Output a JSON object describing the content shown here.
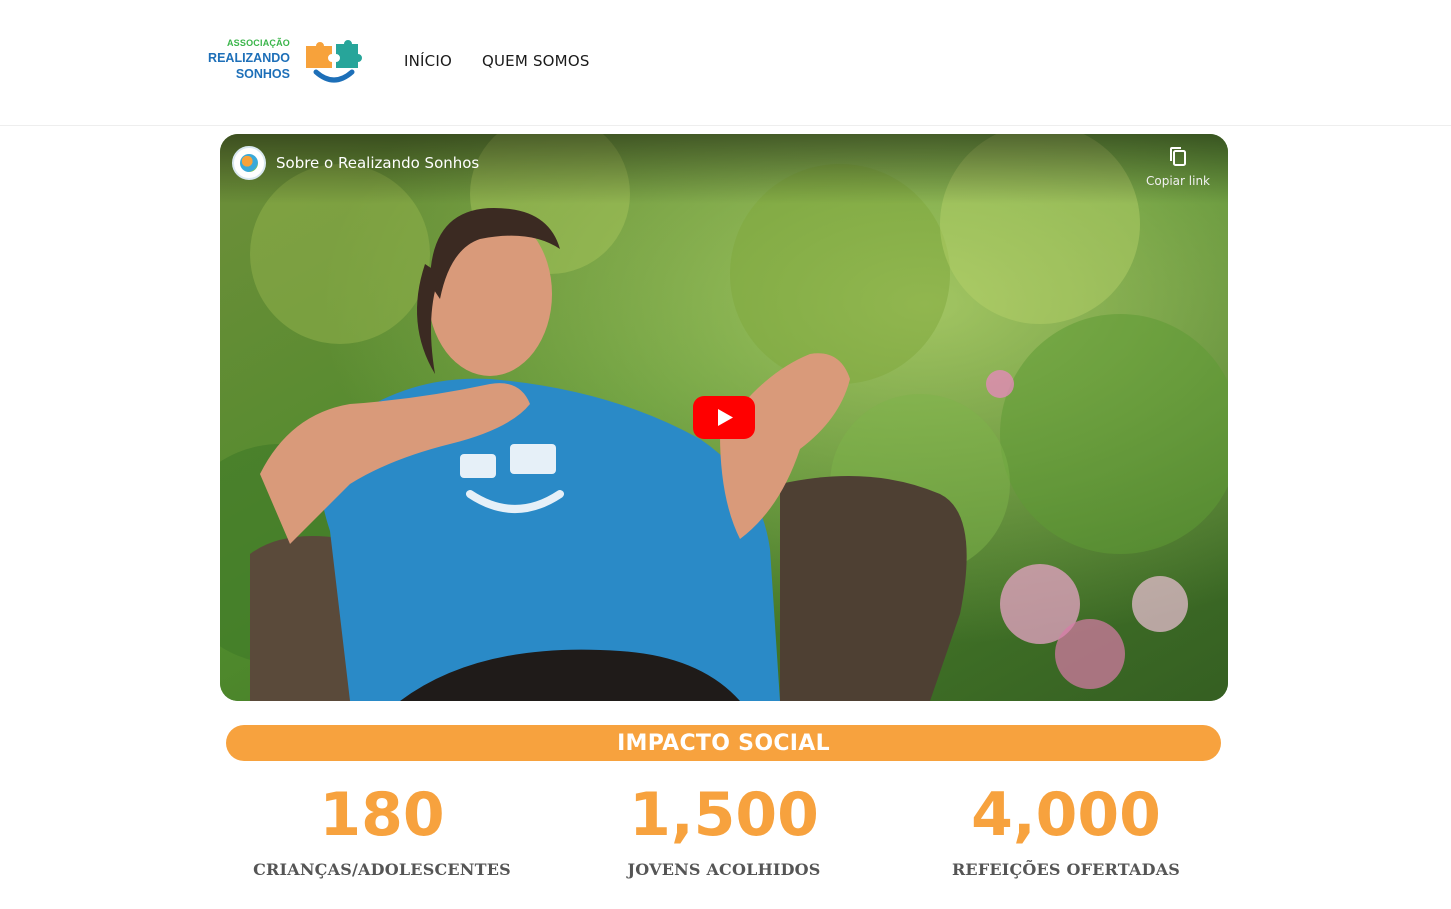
{
  "header": {
    "logo": {
      "line1": "ASSOCIAÇÃO",
      "line2": "REALIZANDO",
      "line3": "SONHOS",
      "colors": {
        "green": "#3ab54a",
        "blue": "#1d6fb8",
        "orange": "#f7a23b",
        "teal": "#27a59a"
      }
    },
    "nav": [
      {
        "label": "INÍCIO"
      },
      {
        "label": "QUEM SOMOS"
      }
    ]
  },
  "video": {
    "title": "Sobre o Realizando Sonhos",
    "copy_link_label": "Copiar link",
    "icons": {
      "play": "youtube-play-icon",
      "copy": "copy-icon",
      "channel": "channel-avatar"
    }
  },
  "impact": {
    "title": "IMPACTO SOCIAL",
    "accent_color": "#f7a23e",
    "stats": [
      {
        "value": "180",
        "label": "CRIANÇAS/ADOLESCENTES"
      },
      {
        "value": "1,500",
        "label": "JOVENS ACOLHIDOS"
      },
      {
        "value": "4,000",
        "label": "REFEIÇÕES OFERTADAS"
      }
    ]
  }
}
